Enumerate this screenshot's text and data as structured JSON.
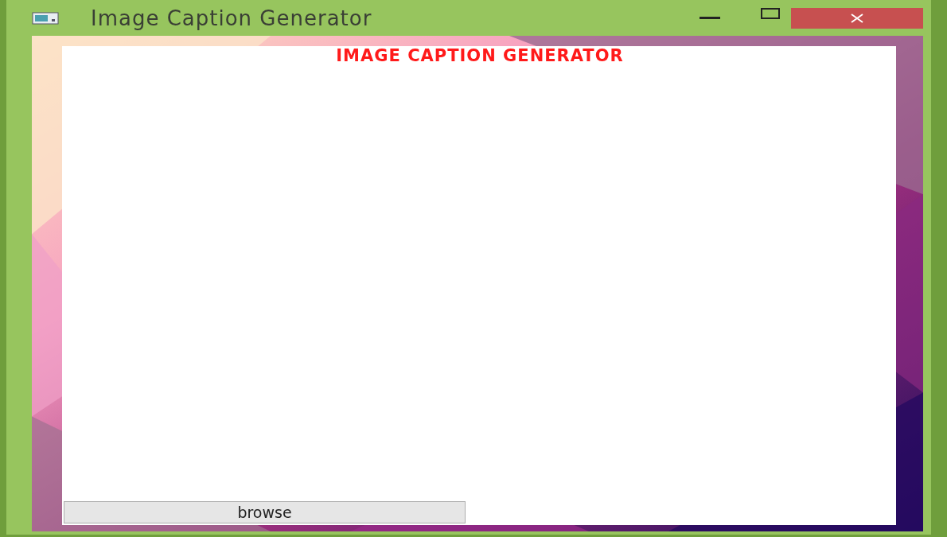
{
  "window": {
    "title": "Image Caption Generator"
  },
  "content": {
    "heading": "IMAGE CAPTION GENERATOR",
    "browse_button": {
      "label": "browse"
    }
  }
}
